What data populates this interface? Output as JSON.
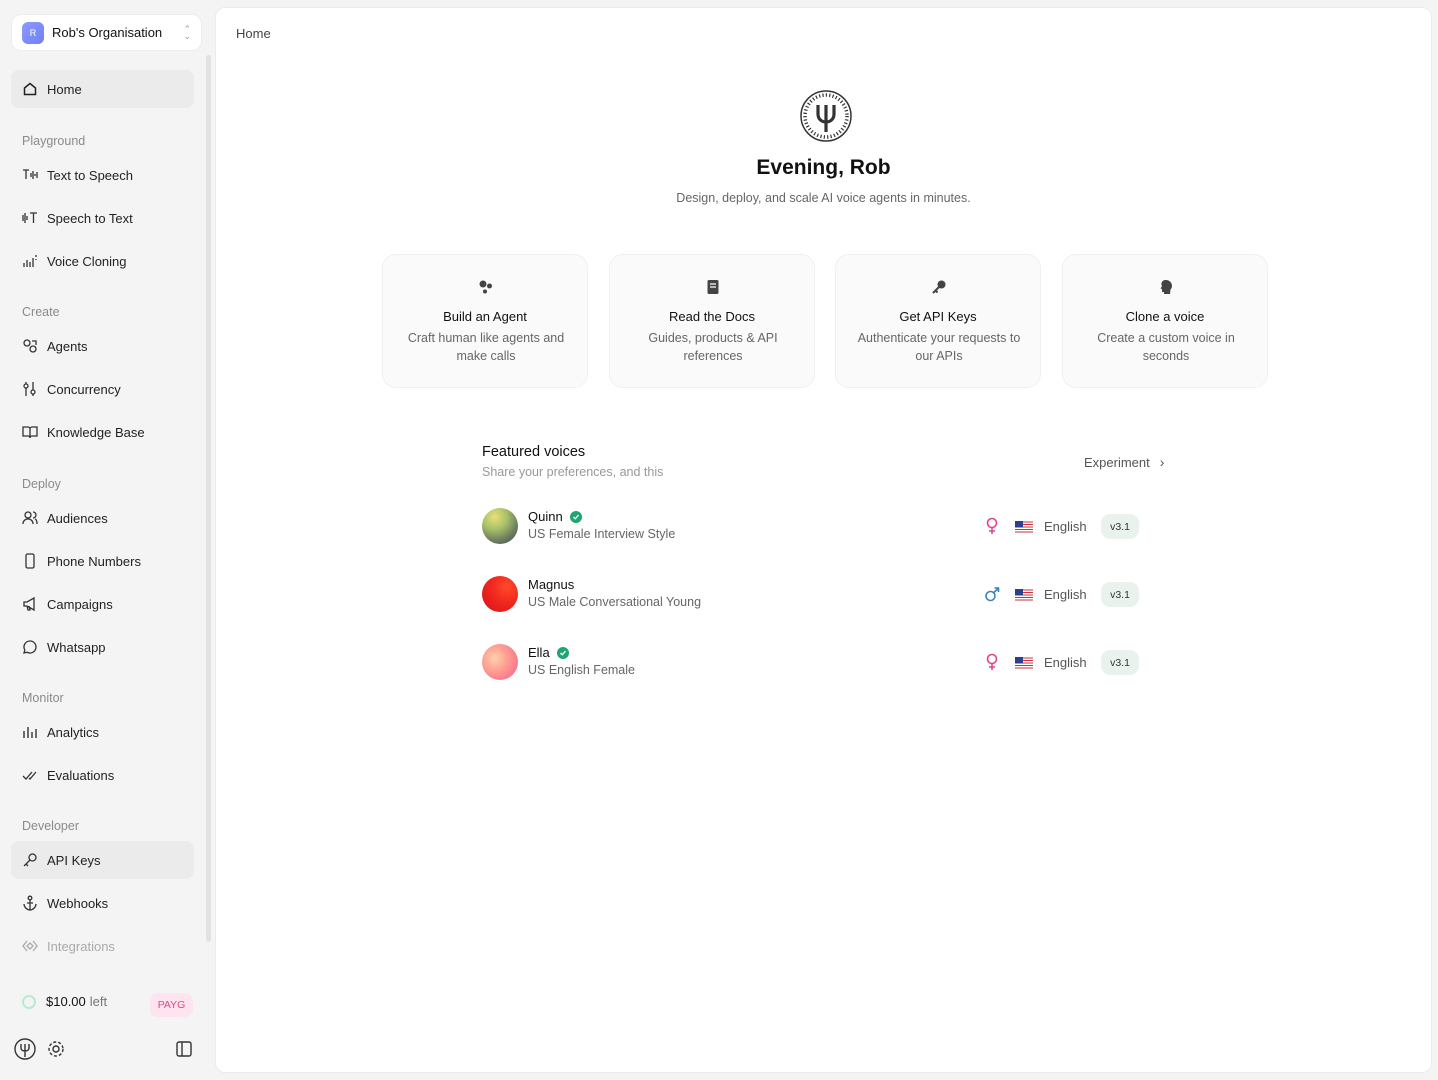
{
  "org": {
    "avatar_letter": "R",
    "name": "Rob's Organisation"
  },
  "nav": {
    "home": "Home",
    "sections": {
      "playground": "Playground",
      "create": "Create",
      "deploy": "Deploy",
      "monitor": "Monitor",
      "developer": "Developer"
    },
    "items": {
      "text_to_speech": "Text to Speech",
      "speech_to_text": "Speech to Text",
      "voice_cloning": "Voice Cloning",
      "agents": "Agents",
      "concurrency": "Concurrency",
      "knowledge_base": "Knowledge Base",
      "audiences": "Audiences",
      "phone_numbers": "Phone Numbers",
      "campaigns": "Campaigns",
      "whatsapp": "Whatsapp",
      "analytics": "Analytics",
      "evaluations": "Evaluations",
      "api_keys": "API Keys",
      "webhooks": "Webhooks",
      "integrations": "Integrations"
    }
  },
  "credit": {
    "amount": "$10.00",
    "suffix": "left",
    "plan": "PAYG"
  },
  "main": {
    "breadcrumb": "Home",
    "greeting": "Evening, Rob",
    "tagline": "Design, deploy, and scale AI voice agents in minutes.",
    "cards": [
      {
        "title": "Build an Agent",
        "desc": "Craft human like agents and make calls",
        "icon": "agent-icon"
      },
      {
        "title": "Read the Docs",
        "desc": "Guides, products & API references",
        "icon": "book-icon"
      },
      {
        "title": "Get API Keys",
        "desc": "Authenticate your requests to our APIs",
        "icon": "key-icon"
      },
      {
        "title": "Clone a voice",
        "desc": "Create a custom voice in seconds",
        "icon": "head-icon"
      }
    ],
    "featured": {
      "title": "Featured voices",
      "subtitle": "Share your preferences, and this",
      "action": "Experiment",
      "voices": [
        {
          "name": "Quinn",
          "desc": "US Female Interview Style",
          "verified": true,
          "gender": "female",
          "language": "English",
          "version": "v3.1"
        },
        {
          "name": "Magnus",
          "desc": "US Male Conversational Young",
          "verified": false,
          "gender": "male",
          "language": "English",
          "version": "v3.1"
        },
        {
          "name": "Ella",
          "desc": "US English Female",
          "verified": true,
          "gender": "female",
          "language": "English",
          "version": "v3.1"
        }
      ]
    }
  },
  "colors": {
    "female": "#e0458f",
    "male": "#3b82c4",
    "verified": "#1ea672",
    "payg_text": "#d94a8c"
  }
}
